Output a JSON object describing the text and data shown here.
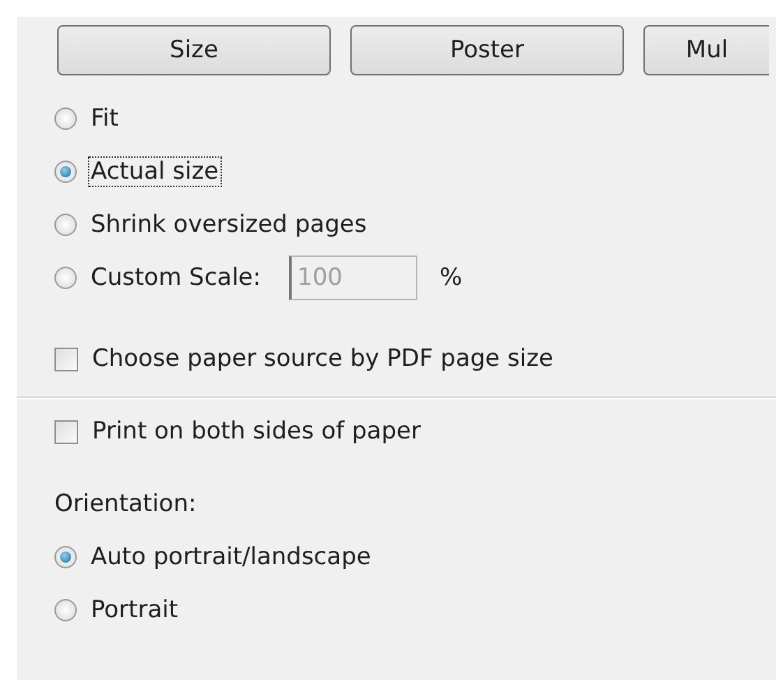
{
  "buttons": [
    {
      "label": "Size"
    },
    {
      "label": "Poster"
    },
    {
      "label": "Mul"
    }
  ],
  "scaling": [
    {
      "label": "Fit",
      "selected": false,
      "focused": false
    },
    {
      "label": "Actual size",
      "selected": true,
      "focused": true
    },
    {
      "label": "Shrink oversized pages",
      "selected": false,
      "focused": false
    },
    {
      "label": "Custom Scale:",
      "selected": false,
      "focused": false
    }
  ],
  "custom_scale": {
    "value": "100",
    "disabled": true,
    "unit": "%"
  },
  "paper_source": {
    "label": "Choose paper source by PDF page size",
    "checked": false
  },
  "duplex": {
    "label": "Print on both sides of paper",
    "checked": false
  },
  "orientation": {
    "label": "Orientation:",
    "options": [
      {
        "label": "Auto portrait/landscape",
        "selected": true,
        "focused": false
      },
      {
        "label": "Portrait",
        "selected": false,
        "focused": false
      }
    ]
  }
}
